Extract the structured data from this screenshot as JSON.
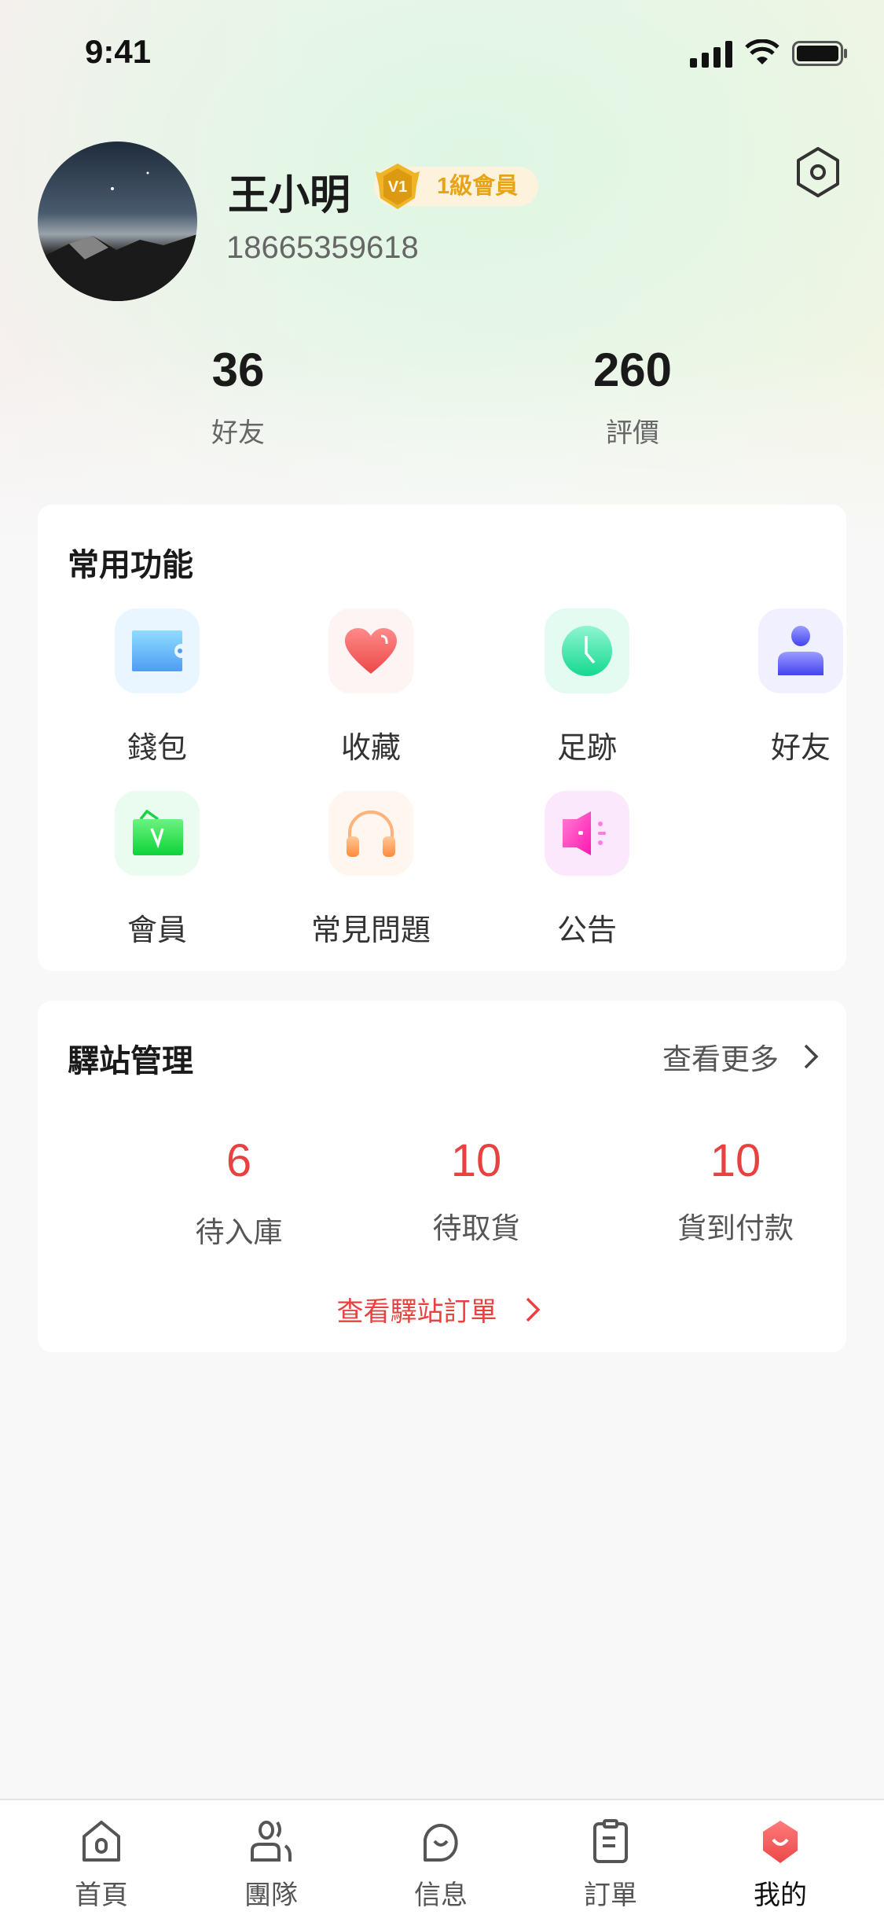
{
  "status_bar": {
    "time": "9:41"
  },
  "profile": {
    "name": "王小明",
    "level_badge": "V1",
    "level_label": "1級會員",
    "phone": "18665359618"
  },
  "stats": [
    {
      "value": "36",
      "label": "好友"
    },
    {
      "value": "260",
      "label": "評價"
    }
  ],
  "common_functions": {
    "title": "常用功能",
    "items": [
      {
        "label": "錢包",
        "icon": "wallet-icon"
      },
      {
        "label": "收藏",
        "icon": "heart-icon"
      },
      {
        "label": "足跡",
        "icon": "clock-icon"
      },
      {
        "label": "好友",
        "icon": "person-icon"
      },
      {
        "label": "會員",
        "icon": "vip-bag-icon"
      },
      {
        "label": "常見問題",
        "icon": "headphones-icon"
      },
      {
        "label": "公告",
        "icon": "megaphone-icon"
      }
    ]
  },
  "station": {
    "title": "驛站管理",
    "more": "查看更多",
    "stats": [
      {
        "value": "6",
        "label": "待入庫"
      },
      {
        "value": "10",
        "label": "待取貨"
      },
      {
        "value": "10",
        "label": "貨到付款"
      }
    ],
    "link": "查看驛站訂單"
  },
  "tabbar": {
    "items": [
      {
        "label": "首頁"
      },
      {
        "label": "團隊"
      },
      {
        "label": "信息"
      },
      {
        "label": "訂單"
      },
      {
        "label": "我的"
      }
    ],
    "active": "我的"
  },
  "colors": {
    "accent": "#e8413f",
    "badge": "#e8a317"
  }
}
